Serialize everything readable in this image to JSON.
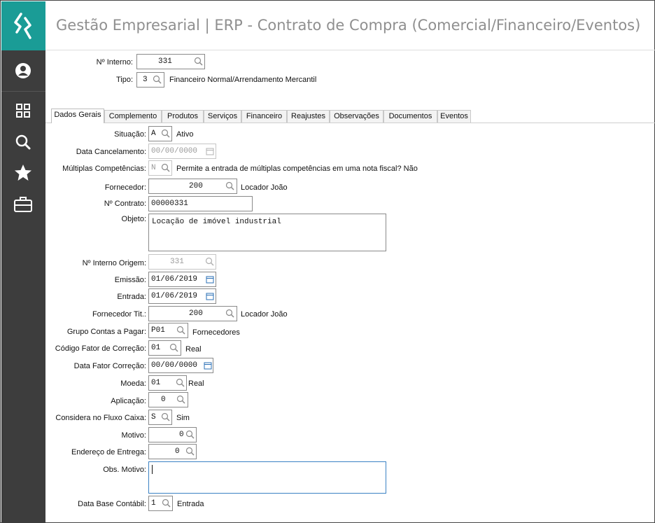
{
  "window": {
    "title": "Gestão Empresarial | ERP - Contrato de Compra (Comercial/Financeiro/Eventos)"
  },
  "sidebar": {
    "items": [
      {
        "icon": "logo-icon"
      },
      {
        "icon": "user-icon"
      },
      {
        "icon": "grid-icon"
      },
      {
        "icon": "search-icon"
      },
      {
        "icon": "star-icon"
      },
      {
        "icon": "briefcase-icon"
      }
    ]
  },
  "header": {
    "interno_label": "Nº Interno:",
    "interno_value": "331",
    "tipo_label": "Tipo:",
    "tipo_value": "3",
    "tipo_desc": "Financeiro Normal/Arrendamento Mercantil"
  },
  "tabs": [
    "Dados Gerais",
    "Complemento",
    "Produtos",
    "Serviços",
    "Financeiro",
    "Reajustes",
    "Observações",
    "Documentos",
    "Eventos"
  ],
  "form": {
    "situacao": {
      "label": "Situação:",
      "value": "A",
      "desc": "Ativo"
    },
    "data_cancelamento": {
      "label": "Data Cancelamento:",
      "value": "00/00/0000"
    },
    "multiplas": {
      "label": "Múltiplas Competências:",
      "value": "N",
      "desc": "Permite a entrada de múltiplas competências em uma nota fiscal?  Não"
    },
    "fornecedor": {
      "label": "Fornecedor:",
      "value": "200",
      "desc": "Locador João"
    },
    "contrato": {
      "label": "Nº Contrato:",
      "value": "00000331"
    },
    "objeto": {
      "label": "Objeto:",
      "value": "Locação de imóvel industrial"
    },
    "interno_origem": {
      "label": "Nº Interno Origem:",
      "value": "331"
    },
    "emissao": {
      "label": "Emissão:",
      "value": "01/06/2019"
    },
    "entrada": {
      "label": "Entrada:",
      "value": "01/06/2019"
    },
    "fornecedor_tit": {
      "label": "Fornecedor Tit.:",
      "value": "200",
      "desc": "Locador João"
    },
    "grupo_contas": {
      "label": "Grupo Contas a Pagar:",
      "value": "P01",
      "desc": "Fornecedores"
    },
    "fator_correcao": {
      "label": "Código Fator de Correção:",
      "value": "01",
      "desc": "Real"
    },
    "data_fator": {
      "label": "Data Fator Correção:",
      "value": "00/00/0000"
    },
    "moeda": {
      "label": "Moeda:",
      "value": "01",
      "desc": "Real"
    },
    "aplicacao": {
      "label": "Aplicação:",
      "value": "0"
    },
    "fluxo_caixa": {
      "label": "Considera no Fluxo Caixa:",
      "value": "S",
      "desc": "Sim"
    },
    "motivo": {
      "label": "Motivo:",
      "value": "0"
    },
    "endereco_entrega": {
      "label": "Endereço de Entrega:",
      "value": "0"
    },
    "obs_motivo": {
      "label": "Obs. Motivo:",
      "value": ""
    },
    "data_base": {
      "label": "Data Base Contábil:",
      "value": "1",
      "desc": "Entrada"
    }
  }
}
